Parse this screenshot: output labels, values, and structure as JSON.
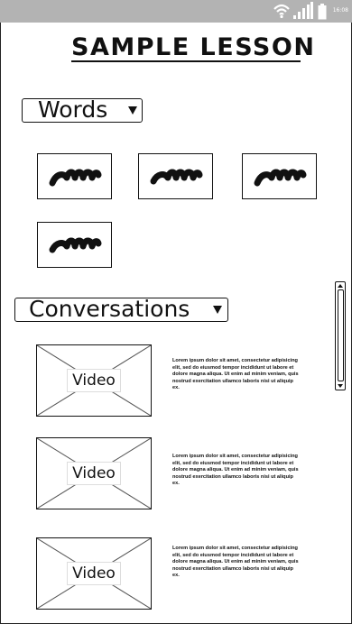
{
  "status_bar": {
    "time": "16:08",
    "wifi_icon": "wifi-icon",
    "signal_icon": "signal-icon",
    "battery_icon": "battery-icon"
  },
  "page": {
    "title": "SAMPLE LESSON"
  },
  "words_section": {
    "dropdown_label": "Words",
    "cards": [
      {
        "icon": "scribble-word-icon"
      },
      {
        "icon": "scribble-word-icon"
      },
      {
        "icon": "scribble-word-icon"
      },
      {
        "icon": "scribble-word-icon"
      }
    ]
  },
  "conversations_section": {
    "dropdown_label": "Conversations",
    "items": [
      {
        "video_label": "Video",
        "text": "Lorem ipsum dolor sit amet, consectetur adipisicing elit, sed do eiusmod tempor incididunt ut labore et dolore magna aliqua. Ut enim ad minim veniam, quis nostrud exercitation ullamco laboris nisi ut aliquip ex."
      },
      {
        "video_label": "Video",
        "text": "Lorem ipsum dolor sit amet, consectetur adipisicing elit, sed do eiusmod tempor incididunt ut labore et dolore magna aliqua. Ut enim ad minim veniam, quis nostrud exercitation ullamco laboris nisi ut aliquip ex."
      },
      {
        "video_label": "Video",
        "text": "Lorem ipsum dolor sit amet, consectetur adipisicing elit, sed do eiusmod tempor incididunt ut labore et dolore magna aliqua. Ut enim ad minim veniam, quis nostrud exercitation ullamco laboris nisi ut aliquip ex."
      }
    ]
  },
  "colors": {
    "status_bar": "#b3b3b3",
    "ink": "#111111",
    "background": "#ffffff"
  }
}
